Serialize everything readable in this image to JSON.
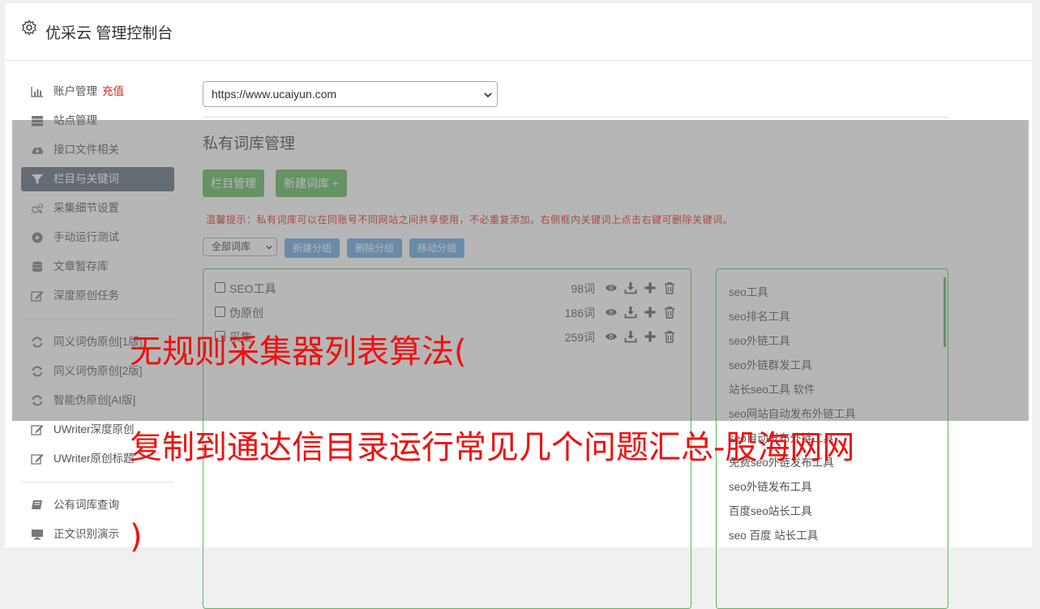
{
  "header": {
    "title": "优采云 管理控制台"
  },
  "sidebar": {
    "items": [
      {
        "label": "账户管理",
        "badge": "充值",
        "icon": "bar-chart-icon"
      },
      {
        "label": "站点管理",
        "icon": "server-icon"
      },
      {
        "label": "接口文件相关",
        "icon": "cloud-upload-icon"
      },
      {
        "label": "栏目与关键词",
        "icon": "filter-icon",
        "active": true
      },
      {
        "label": "采集细节设置",
        "icon": "cogs-icon"
      },
      {
        "label": "手动运行测试",
        "icon": "play-circle-icon"
      },
      {
        "label": "文章暂存库",
        "icon": "database-icon"
      },
      {
        "label": "深度原创任务",
        "icon": "edit-icon"
      },
      {
        "label": "同义词伪原创[1版]",
        "icon": "refresh-icon"
      },
      {
        "label": "同义词伪原创[2版]",
        "icon": "refresh-icon"
      },
      {
        "label": "智能伪原创[AI版]",
        "icon": "refresh-icon"
      },
      {
        "label": "UWriter深度原创",
        "icon": "edit-icon"
      },
      {
        "label": "UWriter原创标题",
        "icon": "edit-icon"
      },
      {
        "label": "公有词库查询",
        "icon": "book-icon"
      },
      {
        "label": "正文识别演示",
        "icon": "monitor-icon"
      }
    ]
  },
  "main": {
    "site_select": "https://www.ucaiyun.com",
    "page_title": "私有词库管理",
    "buttons": {
      "column_manage": "栏目管理",
      "new_library": "新建词库 +"
    },
    "tip": "温馨提示：私有词库可以在同账号不同网站之间共享使用，不必重复添加。右侧框内关键词上点击右键可删除关键词。",
    "library_filter": "全部词库",
    "group_buttons": {
      "new_group": "新建分组",
      "delete_group": "删除分组",
      "move_group": "移动分组"
    },
    "libraries": [
      {
        "name": "SEO工具",
        "count": "98词"
      },
      {
        "name": "伪原创",
        "count": "186词"
      },
      {
        "name": "采集",
        "count": "259词"
      }
    ],
    "keywords": [
      "seo工具",
      "seo排名工具",
      "seo外链工具",
      "seo外链群发工具",
      "站长seo工具 软件",
      "seo网站自动发布外链工具",
      "seo自动发布外链工具",
      "免费seo外链发布工具",
      "seo外链发布工具",
      "百度seo站长工具",
      "seo 百度 站长工具"
    ]
  },
  "overlay_text": {
    "line1": "无规则采集器列表算法(",
    "line2": "复制到通达信目录运行常见几个问题汇总-股海网网",
    "line3": ")"
  },
  "colors": {
    "green": "#5cb85c",
    "blue": "#67a8e0",
    "red": "#f01010",
    "active_bg": "#5d6b7b"
  }
}
